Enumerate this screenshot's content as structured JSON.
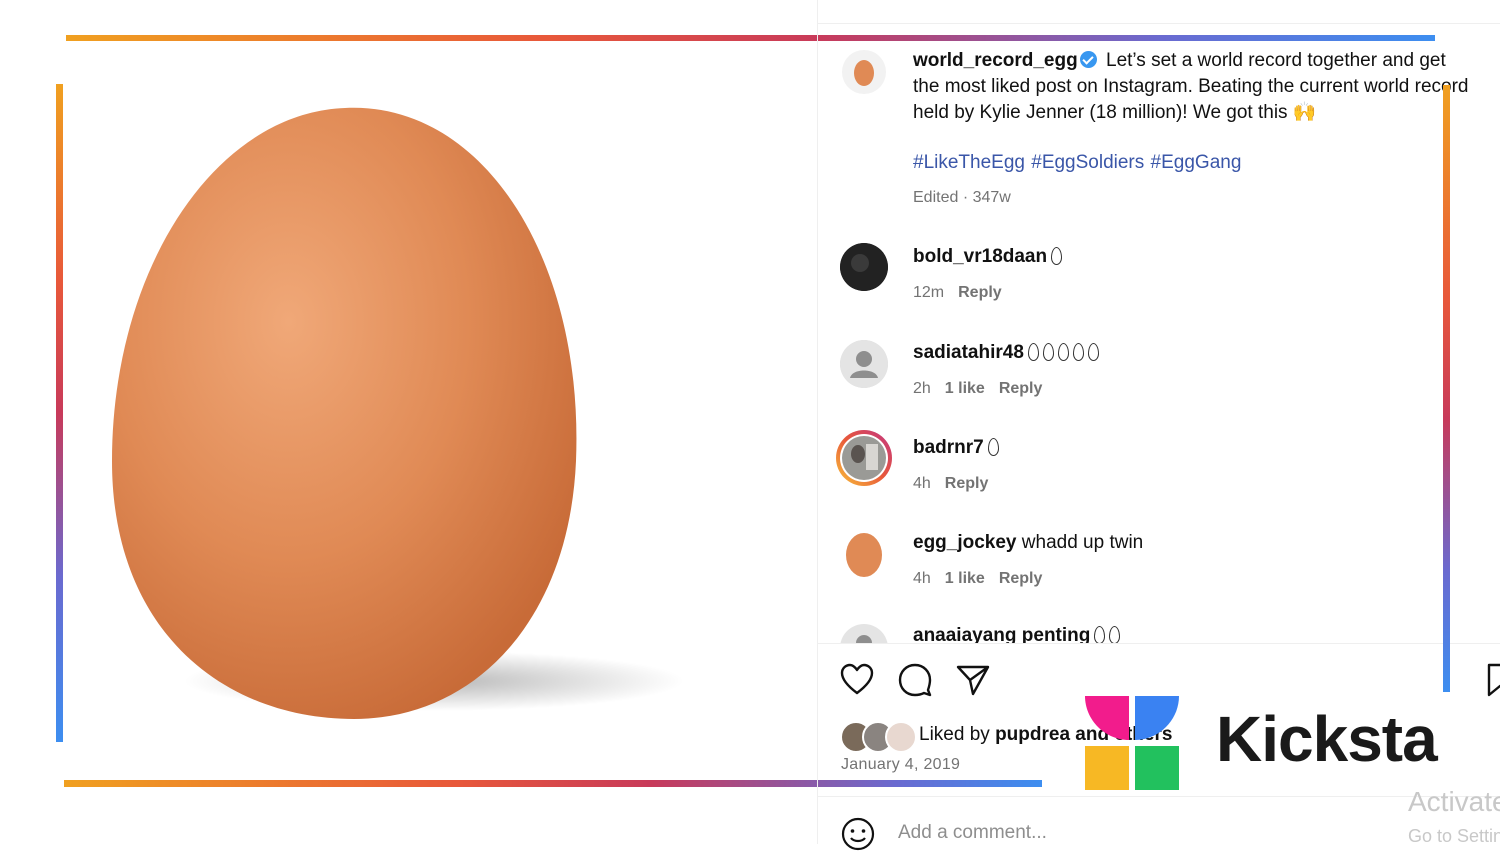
{
  "post": {
    "author": "world_record_egg",
    "caption": "Let’s set a world record together and get the most liked post on Instagram. Beating the current world record held by Kylie Jenner (18 million)! We got this 🙌",
    "hashtags": "#LikeTheEgg #EggSoldiers #EggGang",
    "edited": "Edited · 347w",
    "date": "January 4, 2019",
    "liked_by_prefix": "Liked by",
    "liked_by_user": "pupdrea",
    "liked_by_suffix": "and others"
  },
  "comments": [
    {
      "user": "bold_vr18daan",
      "eggs": 1,
      "text": "",
      "time": "12m",
      "likes": "",
      "reply": "Reply"
    },
    {
      "user": "sadiatahir48",
      "eggs": 5,
      "text": "",
      "time": "2h",
      "likes": "1 like",
      "reply": "Reply"
    },
    {
      "user": "badrnr7",
      "eggs": 1,
      "text": "",
      "time": "4h",
      "likes": "",
      "reply": "Reply"
    },
    {
      "user": "egg_jockey",
      "eggs": 0,
      "text": "whadd up twin",
      "time": "4h",
      "likes": "1 like",
      "reply": "Reply"
    },
    {
      "user": "anaaiayang penting",
      "eggs": 2,
      "text": "",
      "time": "",
      "likes": "",
      "reply": ""
    }
  ],
  "composer": {
    "placeholder": "Add a comment..."
  },
  "watermark": {
    "brand": "Kicksta"
  },
  "activation": {
    "title": "Activate",
    "subtitle": "Go to Settings"
  },
  "colors": {
    "link": "#3a56a8",
    "verified": "#3897f0",
    "muted": "#737373"
  }
}
